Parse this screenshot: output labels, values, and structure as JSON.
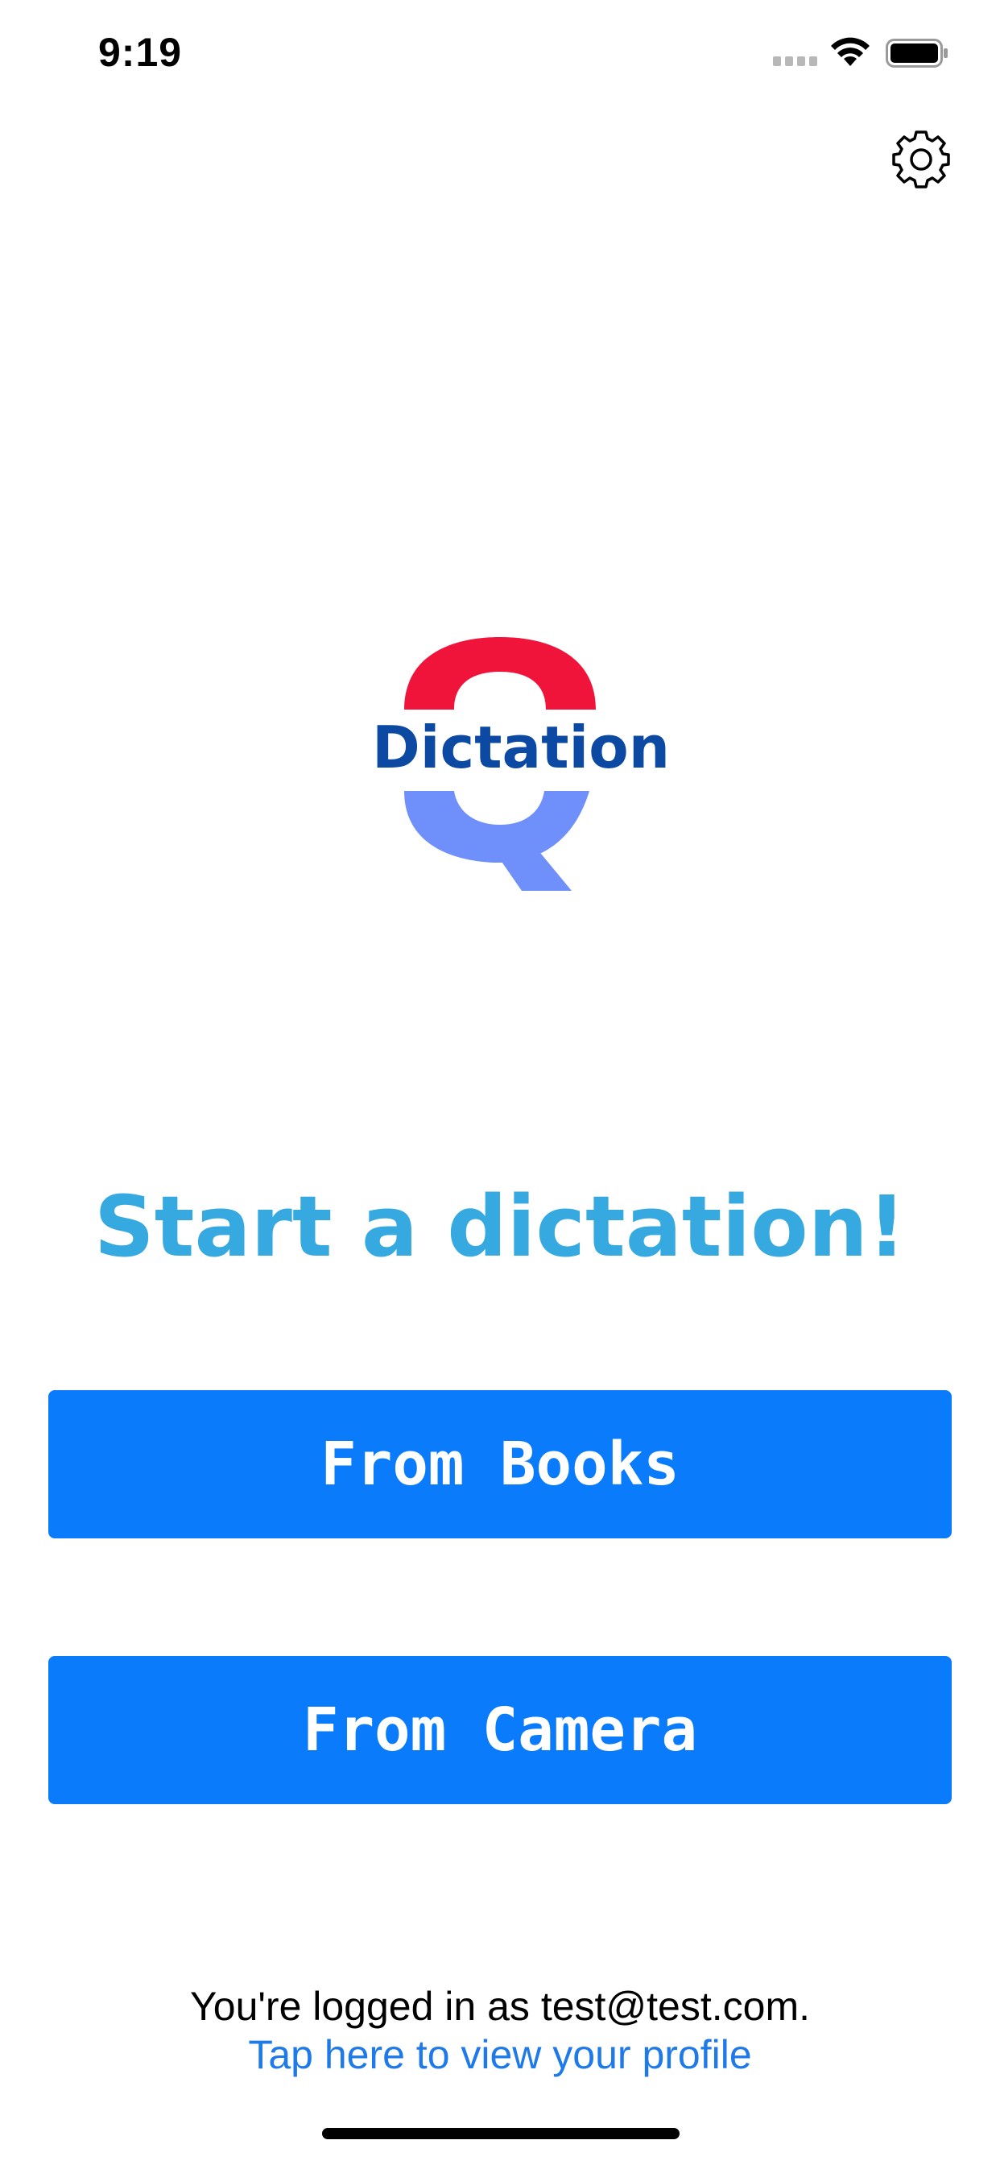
{
  "status_bar": {
    "time": "9:19"
  },
  "settings": {
    "icon": "gear-icon"
  },
  "logo": {
    "text": "Dictation",
    "colors": {
      "top": "#f0143a",
      "bottom": "#6f8ffb",
      "text": "#0b49a3"
    }
  },
  "main": {
    "heading": "Start a dictation!",
    "buttons": {
      "books": "From Books",
      "camera": "From Camera"
    }
  },
  "footer": {
    "login_text": "You're logged in as test@test.com.",
    "profile_link": "Tap here to view your profile"
  },
  "colors": {
    "accent": "#0a7bfa",
    "heading": "#35a9e0",
    "link": "#1f7ae9"
  }
}
